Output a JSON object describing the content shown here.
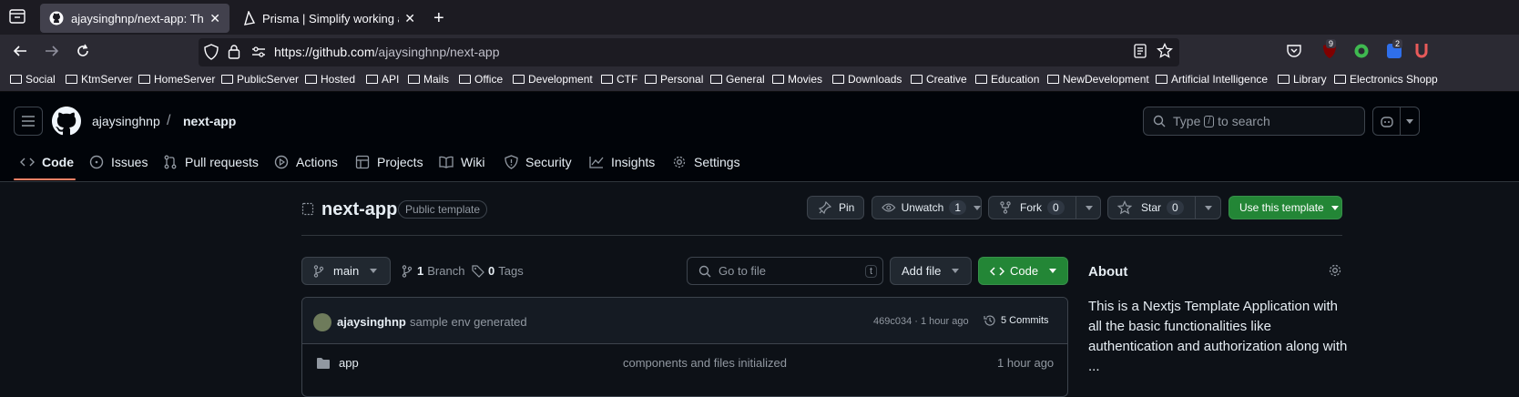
{
  "browser": {
    "tabs": [
      {
        "title": "ajaysinghnp/next-app: This is a",
        "active": true
      },
      {
        "title": "Prisma | Simplify working and in",
        "active": false
      }
    ],
    "url": {
      "host": "https://github.com",
      "path": "/ajaysinghnp/next-app"
    },
    "extension_badges": {
      "ublock": "9",
      "other": "2"
    },
    "bookmarks": [
      "Social",
      "KtmServer",
      "HomeServer",
      "PublicServer",
      "Hosted",
      "API",
      "Mails",
      "Office",
      "Development",
      "CTF",
      "Personal",
      "General",
      "Movies",
      "Downloads",
      "Creative",
      "Education",
      "NewDevelopment",
      "Artificial Intelligence",
      "Library",
      "Electronics Shopp"
    ]
  },
  "github": {
    "owner": "ajaysinghnp",
    "separator": "/",
    "repo": "next-app",
    "search": {
      "prefix": "Type",
      "key": "/",
      "suffix": "to search"
    },
    "nav": [
      "Code",
      "Issues",
      "Pull requests",
      "Actions",
      "Projects",
      "Wiki",
      "Security",
      "Insights",
      "Settings"
    ]
  },
  "repo": {
    "name": "next-app",
    "visibility": "Public template",
    "pin_label": "Pin",
    "watch_label": "Unwatch",
    "watch_count": "1",
    "fork_label": "Fork",
    "fork_count": "0",
    "star_label": "Star",
    "star_count": "0",
    "template_label": "Use this template",
    "branch": "main",
    "branch_count": "1",
    "branch_label": "Branch",
    "tag_count": "0",
    "tag_label": "Tags",
    "goto_placeholder": "Go to file",
    "goto_key": "t",
    "add_file_label": "Add file",
    "code_label": "Code",
    "commit": {
      "author": "ajaysinghnp",
      "message": "sample env generated",
      "hash": "469c034",
      "time": "· 1 hour ago",
      "commits_label": "5 Commits"
    },
    "files": [
      {
        "name": "app",
        "message": "components and files initialized",
        "time": "1 hour ago"
      }
    ],
    "about": {
      "title": "About",
      "description": "This is a Nextjs Template Application with all the basic functionalities like authentication and authorization along with ..."
    }
  }
}
